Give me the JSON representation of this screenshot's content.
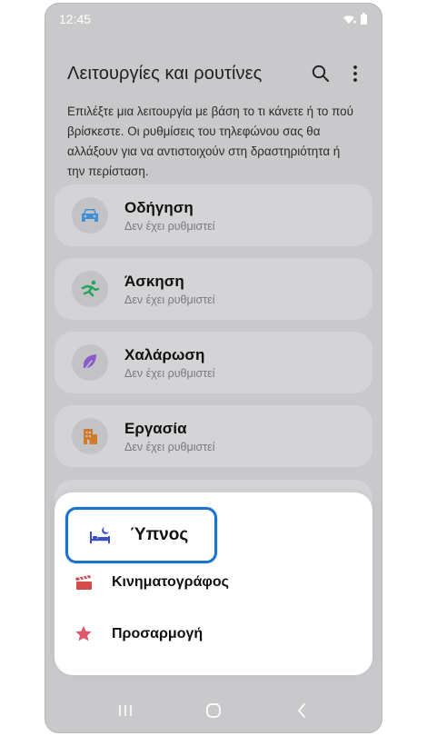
{
  "status_bar": {
    "time": "12:45"
  },
  "header": {
    "title": "Λειτουργίες και ρουτίνες"
  },
  "description": "Επιλέξτε μια λειτουργία με βάση το τι κάνετε ή το πού βρίσκεστε. Οι ρυθμίσεις του τηλεφώνου σας θα αλλάξουν για να αντιστοιχούν στη δραστηριότητα ή την περίσταση.",
  "modes": [
    {
      "title": "Οδήγηση",
      "subtitle": "Δεν έχει ρυθμιστεί",
      "icon": "car-icon",
      "color": "#3e8fd6"
    },
    {
      "title": "Άσκηση",
      "subtitle": "Δεν έχει ρυθμιστεί",
      "icon": "running-icon",
      "color": "#27a35a"
    },
    {
      "title": "Χαλάρωση",
      "subtitle": "Δεν έχει ρυθμιστεί",
      "icon": "leaf-icon",
      "color": "#8a5cc9"
    },
    {
      "title": "Εργασία",
      "subtitle": "Δεν έχει ρυθμιστεί",
      "icon": "building-icon",
      "color": "#d27a2c"
    }
  ],
  "sheet": {
    "sleep": {
      "label": "Ύπνος",
      "icon": "bed-icon",
      "color": "#3d4fc7"
    },
    "items": [
      {
        "label": "Κινηματογράφος",
        "icon": "clapperboard-icon",
        "color": "#d24c4c"
      },
      {
        "label": "Προσαρμογή",
        "icon": "star-icon",
        "color": "#e0566a"
      }
    ],
    "highlight_color": "#1a73c9"
  }
}
